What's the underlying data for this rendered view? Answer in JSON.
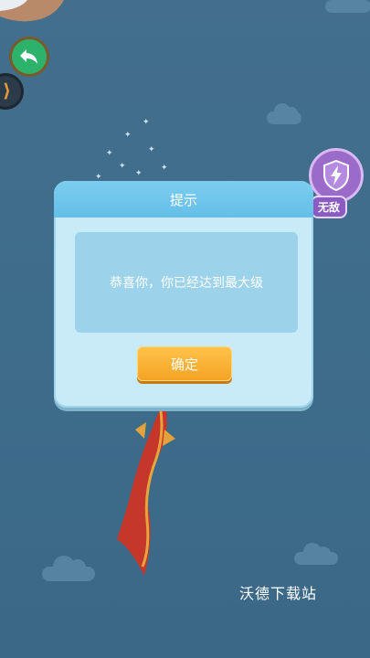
{
  "dialog": {
    "title": "提示",
    "message": "恭喜你，你已经达到最大级",
    "confirm_label": "确定"
  },
  "hud": {
    "shield_badge_label": "无敌",
    "back_icon": "back-arrow-icon",
    "shield_icon": "lightning-shield-icon"
  },
  "watermark": {
    "text": "沃德下载站"
  },
  "colors": {
    "background": "#3f6f8f",
    "dialog_bg": "#c9ebf7",
    "dialog_header": "#64bfe8",
    "confirm_button": "#f4a424",
    "back_button": "#2db26b",
    "shield_button": "#9b6bc9"
  }
}
